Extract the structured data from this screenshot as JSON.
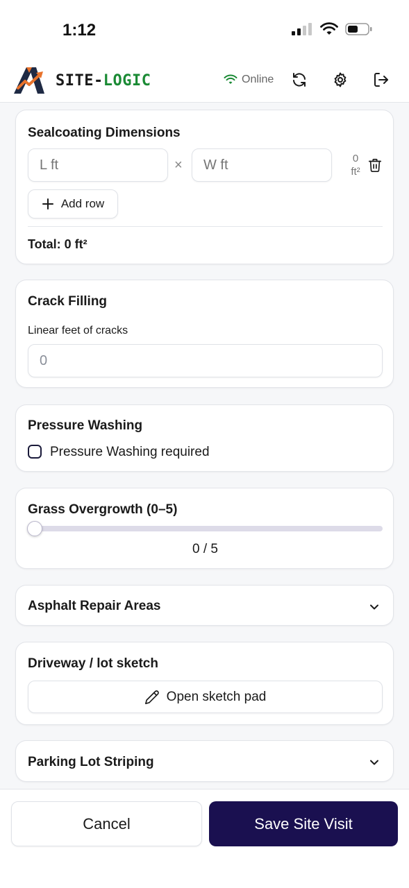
{
  "status_bar": {
    "time": "1:12"
  },
  "header": {
    "brand_part1": "SITE-",
    "brand_part2": "LOGIC",
    "connection_status": "Online",
    "accent_color": "#1a8a34",
    "icons": [
      "wifi-icon",
      "sync-icon",
      "settings-icon",
      "logout-icon"
    ]
  },
  "sealcoating": {
    "title": "Sealcoating Dimensions",
    "length_placeholder": "L ft",
    "width_placeholder": "W ft",
    "times_symbol": "×",
    "row_area_value": "0",
    "row_area_unit": "ft²",
    "add_row_label": "Add row",
    "total_label": "Total: 0 ft²"
  },
  "crack_filling": {
    "title": "Crack Filling",
    "field_label": "Linear feet of cracks",
    "field_value": "0"
  },
  "pressure_washing": {
    "title": "Pressure Washing",
    "checkbox_label": "Pressure Washing required",
    "checked": false
  },
  "grass_overgrowth": {
    "title": "Grass Overgrowth (0–5)",
    "value": 0,
    "max": 5,
    "value_text": "0 / 5"
  },
  "asphalt_repair": {
    "title": "Asphalt Repair Areas"
  },
  "sketch": {
    "title": "Driveway / lot sketch",
    "button_label": "Open sketch pad"
  },
  "striping": {
    "title": "Parking Lot Striping"
  },
  "footer": {
    "cancel_label": "Cancel",
    "save_label": "Save Site Visit",
    "save_color": "#1a1050"
  }
}
